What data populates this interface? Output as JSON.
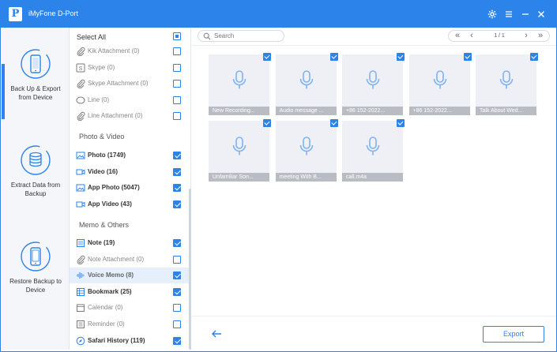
{
  "titlebar": {
    "logo": "P",
    "title": "iMyFone D-Port",
    "settings_icon": "gear-icon",
    "menu_icon": "menu-icon",
    "minimize_icon": "minimize-icon",
    "close_icon": "close-icon"
  },
  "leftnav": {
    "items": [
      {
        "label": "Back Up & Export from Device",
        "icon": "phone-icon",
        "active": true
      },
      {
        "label": "Extract Data from Backup",
        "icon": "database-icon",
        "active": false
      },
      {
        "label": "Restore Backup to Device",
        "icon": "phone-restore-icon",
        "active": false
      }
    ]
  },
  "categories": {
    "select_all": "Select All",
    "top_items": [
      {
        "label": "Kik Attachment (0)",
        "icon": "paperclip-icon",
        "checked": false
      },
      {
        "label": "Skype (0)",
        "icon": "skype-icon",
        "checked": false
      },
      {
        "label": "Skype Attachment (0)",
        "icon": "paperclip-icon",
        "checked": false
      },
      {
        "label": "Line (0)",
        "icon": "line-icon",
        "checked": false
      },
      {
        "label": "Line Attachment (0)",
        "icon": "paperclip-icon",
        "checked": false
      }
    ],
    "photo_section": "Photo & Video",
    "photo_items": [
      {
        "label": "Photo (1749)",
        "icon": "image-icon",
        "checked": true
      },
      {
        "label": "Video (16)",
        "icon": "video-icon",
        "checked": true
      },
      {
        "label": "App Photo (5047)",
        "icon": "image-icon",
        "checked": true
      },
      {
        "label": "App Video (43)",
        "icon": "video-icon",
        "checked": true
      }
    ],
    "memo_section": "Memo & Others",
    "memo_items": [
      {
        "label": "Note (19)",
        "icon": "note-icon",
        "checked": true
      },
      {
        "label": "Note Attachment (0)",
        "icon": "paperclip-icon",
        "checked": false
      },
      {
        "label": "Voice Memo (8)",
        "icon": "waveform-icon",
        "checked": true,
        "selected": true
      },
      {
        "label": "Bookmark (25)",
        "icon": "bookmark-icon",
        "checked": true
      },
      {
        "label": "Calendar (0)",
        "icon": "calendar-icon",
        "checked": false
      },
      {
        "label": "Reminder (0)",
        "icon": "reminder-icon",
        "checked": false
      },
      {
        "label": "Safari History (119)",
        "icon": "compass-icon",
        "checked": true
      }
    ]
  },
  "toolbar": {
    "search_placeholder": "Search",
    "pager": {
      "text": "1 / 1"
    }
  },
  "memos": [
    {
      "name": "New Recording..."
    },
    {
      "name": "Audio message ..."
    },
    {
      "name": "+86 152-2022..."
    },
    {
      "name": "+86 152-2022..."
    },
    {
      "name": "Talk About Wed..."
    },
    {
      "name": "Unfamiliar Son..."
    },
    {
      "name": "meeting With B..."
    },
    {
      "name": "call.m4a"
    }
  ],
  "footer": {
    "export_label": "Export"
  },
  "colors": {
    "accent": "#2c83ea",
    "tile_bg": "#eef0f5",
    "caption_bg": "#b9bcc3"
  }
}
